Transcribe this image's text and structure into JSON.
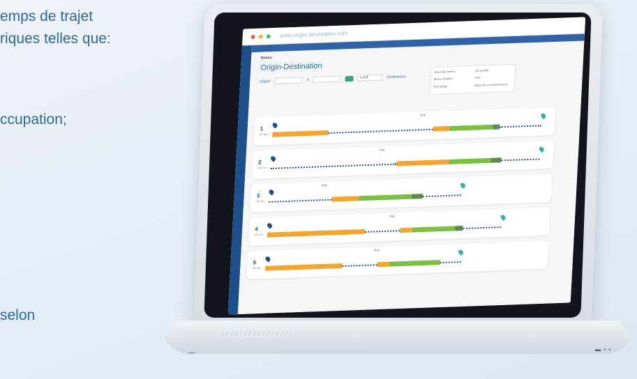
{
  "left_text": [
    "emps de trajet",
    "riques telles que:",
    "ccupation;",
    "selon"
  ],
  "browser": {
    "url": "www.origin-destination.com",
    "dots": [
      "#e85c5c",
      "#f2b431",
      "#3cc26e"
    ]
  },
  "app": {
    "breadcrumb": "Retour",
    "title": "Origin-Destination",
    "filters": {
      "from_label": "Départ",
      "to_label": "À",
      "select_value": "Lundi"
    },
    "preferences_label": "Préférences",
    "preferences": [
      "Moins de marche",
      "Accessible",
      "Moins d'attente",
      "Vélo",
      "Plus rapide",
      "Moins de correspondances"
    ],
    "routes": [
      {
        "num": "1",
        "meta": "45 min",
        "stop": "Stop"
      },
      {
        "num": "2",
        "meta": "45 min",
        "stop": "Stop"
      },
      {
        "num": "3",
        "meta": "35 min",
        "stop": "Stop"
      },
      {
        "num": "4",
        "meta": "40 min",
        "stop": "Stop"
      },
      {
        "num": "5",
        "meta": "40 min",
        "stop": "Stop"
      }
    ]
  },
  "colors": {
    "orange": "#f2a531",
    "green": "#7bc043",
    "darkgreen": "#5c8a4a",
    "navy": "#1e4f82",
    "teal": "#2fb3a8"
  },
  "keyboard_text": "////////////////",
  "ports_text": "▬ ▪ ▪"
}
